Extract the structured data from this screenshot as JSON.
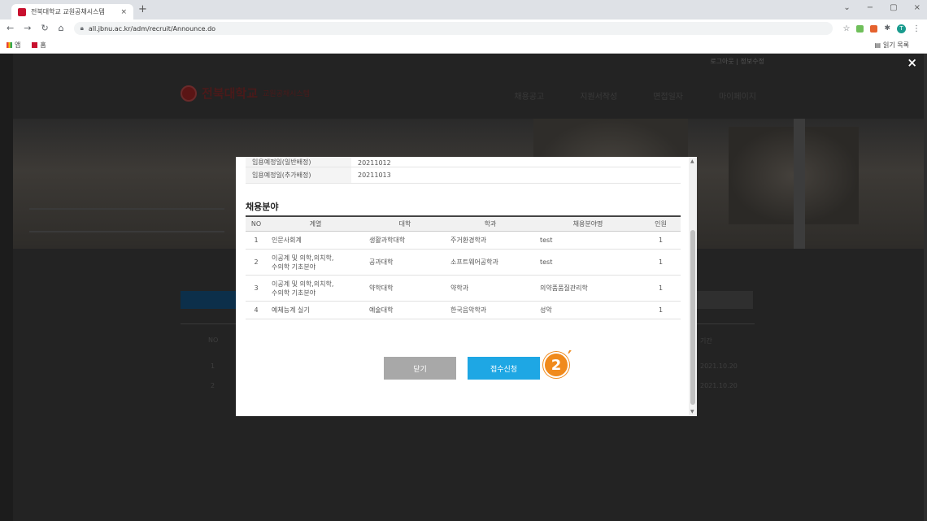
{
  "browser": {
    "tab_title": "전북대학교 교원공채시스템",
    "tab_close": "×",
    "new_tab": "+",
    "url": "all.jbnu.ac.kr/adm/recruit/Announce.do",
    "window_controls": [
      "⌄",
      "−",
      "▢",
      "×"
    ],
    "bookmarks": [
      "앱",
      "홈"
    ],
    "reading_list": "읽기 목록",
    "profile_initial": "T"
  },
  "site": {
    "logo_name": "전북대학교",
    "logo_sub": "교원공채시스템",
    "nav": [
      "채용공고",
      "지원서작성",
      "면접일자",
      "마이페이지"
    ],
    "top_info": "로그아웃  |  정보수정",
    "bg_rows": [
      {
        "no": "NO",
        "date": "기간"
      },
      {
        "no": "1",
        "date": "2021.10.20"
      },
      {
        "no": "2",
        "date": "2021.10.20"
      }
    ]
  },
  "modal": {
    "schedule": [
      {
        "key": "임용예정일(일반배정)",
        "value": "20211012"
      },
      {
        "key": "임용예정일(추가배정)",
        "value": "20211013"
      }
    ],
    "section_title": "채용분야",
    "table_headers": [
      "NO",
      "계열",
      "대학",
      "학과",
      "채용분야명",
      "인원"
    ],
    "rows": [
      {
        "no": "1",
        "field": "인문사회계",
        "college": "생활과학대학",
        "dept": "주거환경학과",
        "name": "test",
        "count": "1"
      },
      {
        "no": "2",
        "field": "이공계 및 의학,의치학,\n수의학 기초분야",
        "college": "공과대학",
        "dept": "소프트웨어공학과",
        "name": "test",
        "count": "1"
      },
      {
        "no": "3",
        "field": "이공계 및 의학,의치학,\n수의학 기초분야",
        "college": "약학대학",
        "dept": "약학과",
        "name": "의약품품질관리학",
        "count": "1"
      },
      {
        "no": "4",
        "field": "예체능계 실기",
        "college": "예술대학",
        "dept": "한국음악학과",
        "name": "성악",
        "count": "1"
      }
    ],
    "close_label": "닫기",
    "apply_label": "접수신청",
    "step_marker": "2",
    "step_prime": "′"
  },
  "overlay_close": "×",
  "colors": {
    "apply": "#1ea7e4",
    "close": "#a8a8a8",
    "marker": "#f08a1c"
  }
}
